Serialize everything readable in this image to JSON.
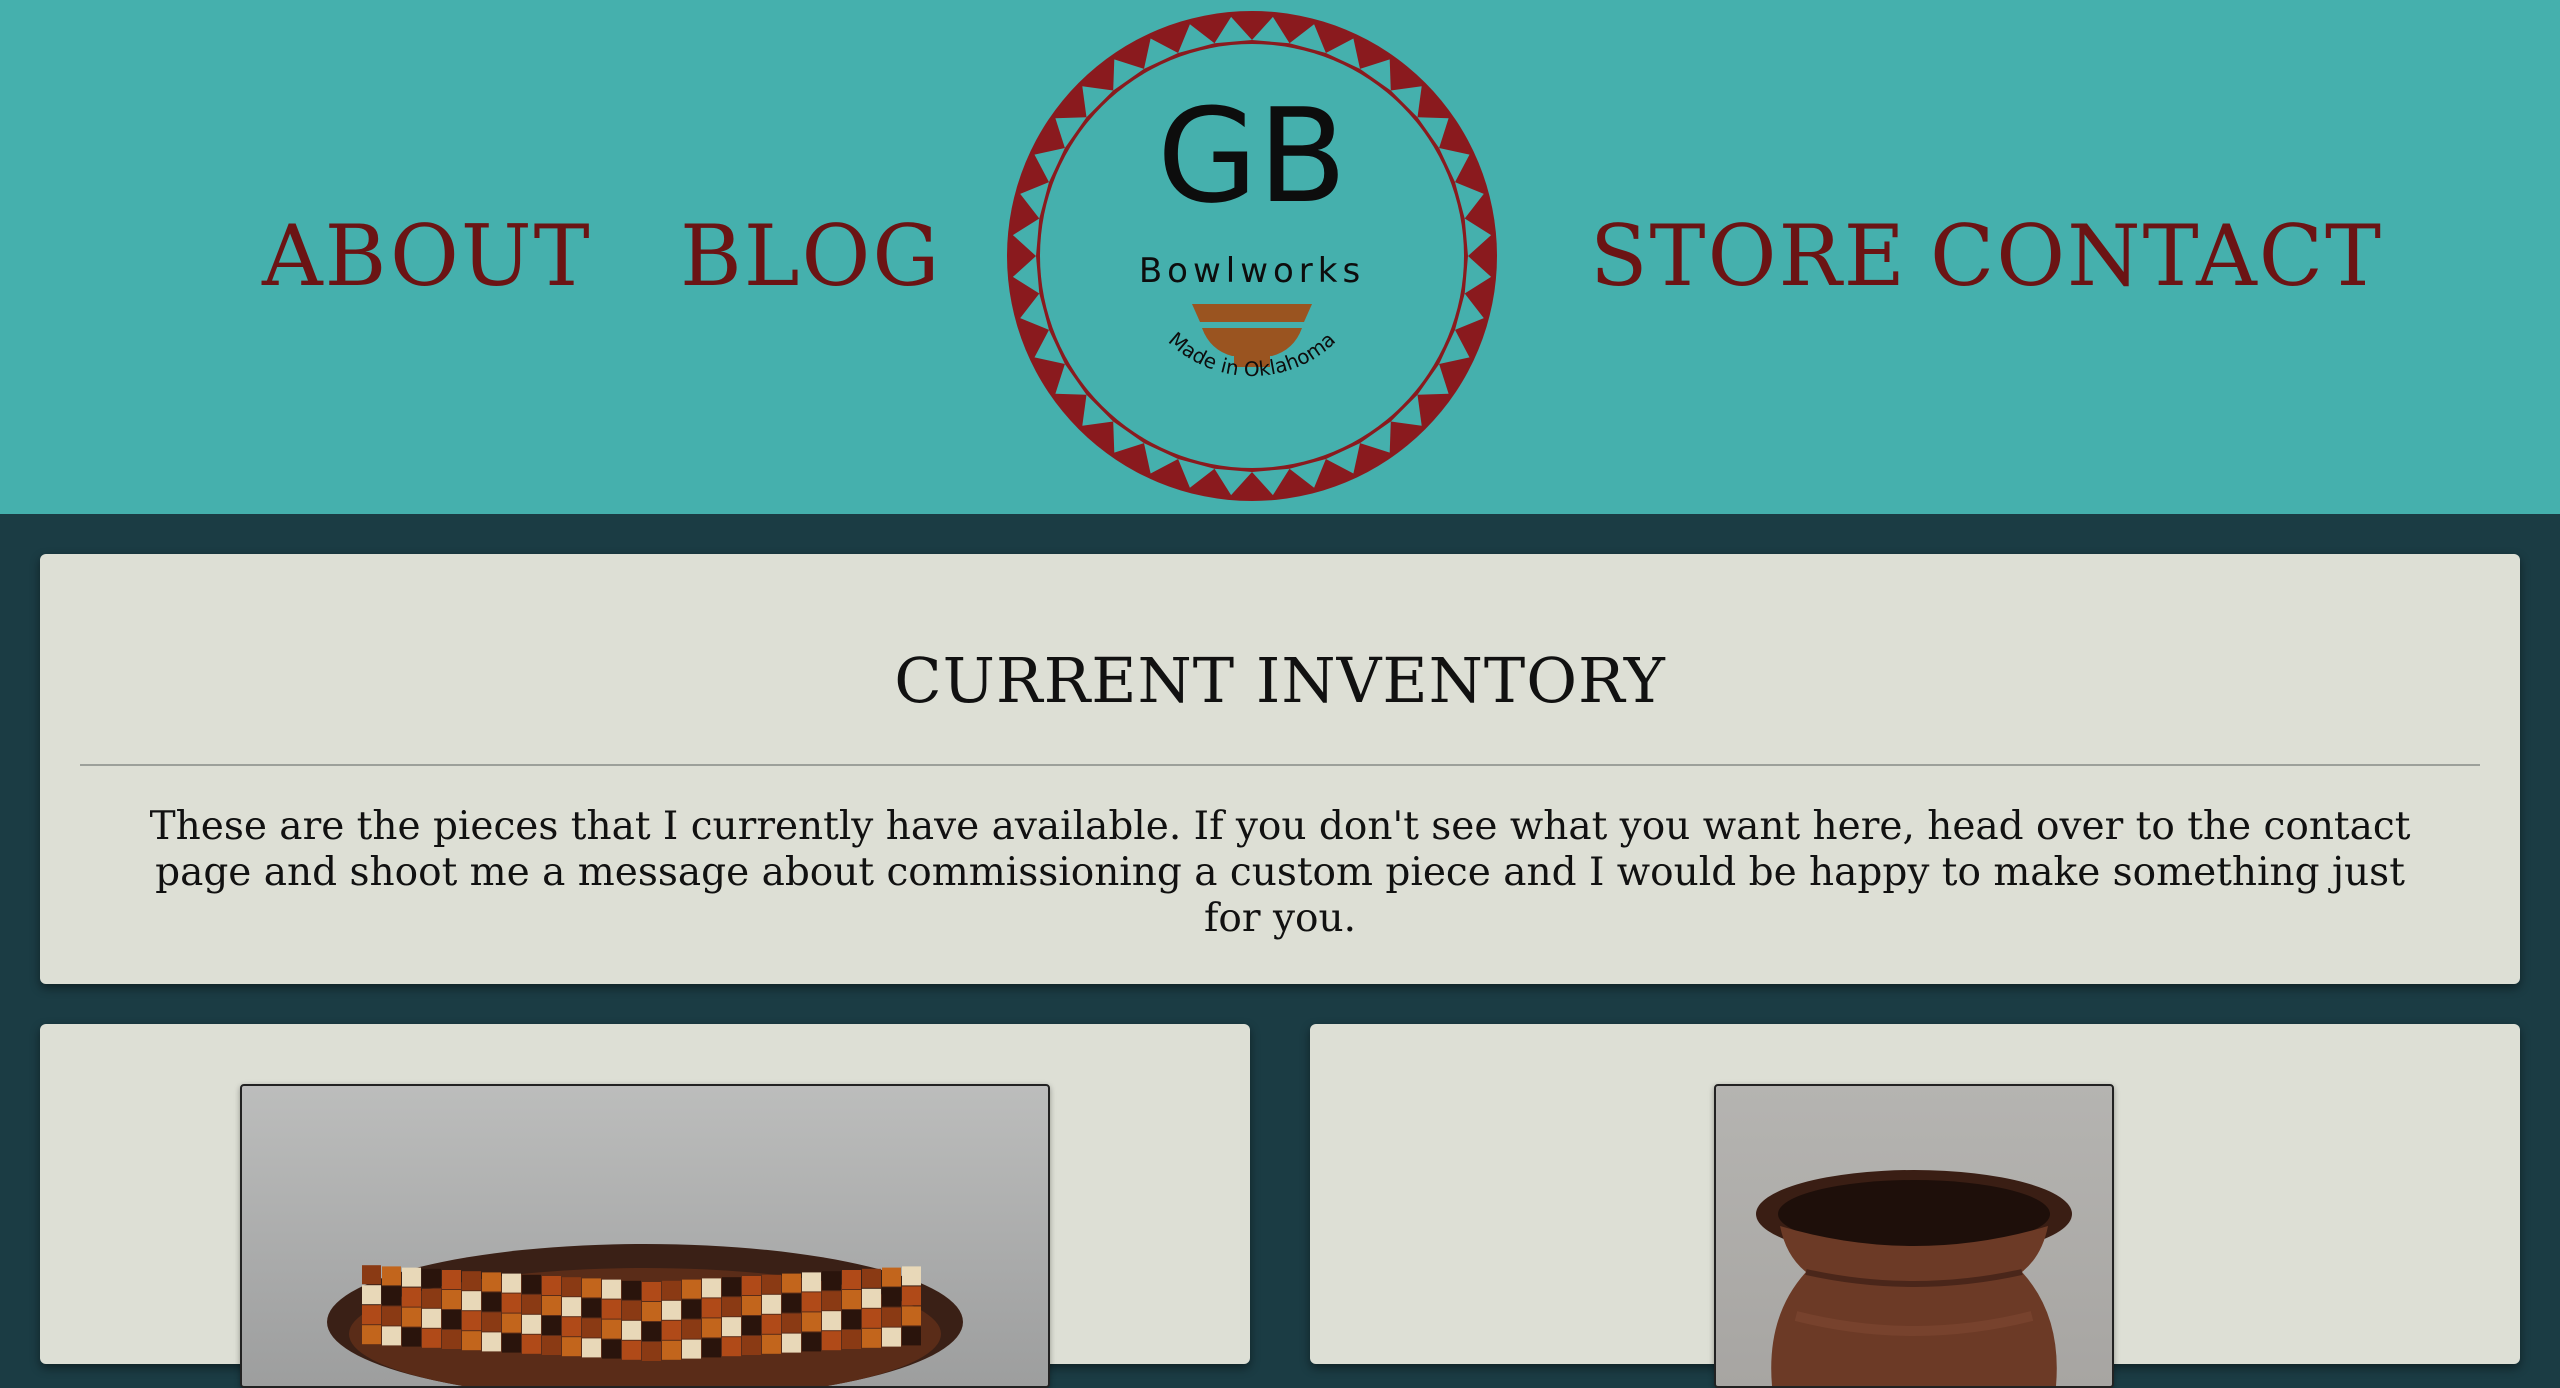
{
  "nav": {
    "about": "ABOUT",
    "blog": "BLOG",
    "store": "STORE",
    "contact": "CONTACT"
  },
  "logo": {
    "initials": "GB",
    "name": "Bowlworks",
    "tagline": "Made in Oklahoma"
  },
  "intro": {
    "title": "CURRENT INVENTORY",
    "text": "These are the pieces that I currently have available. If you don't see what you want here, head over to the contact page and shoot me a message about commissioning a custom piece and I would be happy to make something just for you."
  },
  "colors": {
    "header_bg": "#45b0ad",
    "page_bg": "#1b3c44",
    "card_bg": "#dddfd5",
    "nav_text": "#6b1414",
    "logo_ring": "#8a1a1e",
    "logo_bowl": "#9a5420"
  },
  "products": [
    {
      "image": "segmented-wood-bowl-photo"
    },
    {
      "image": "wooden-vase-photo"
    }
  ]
}
